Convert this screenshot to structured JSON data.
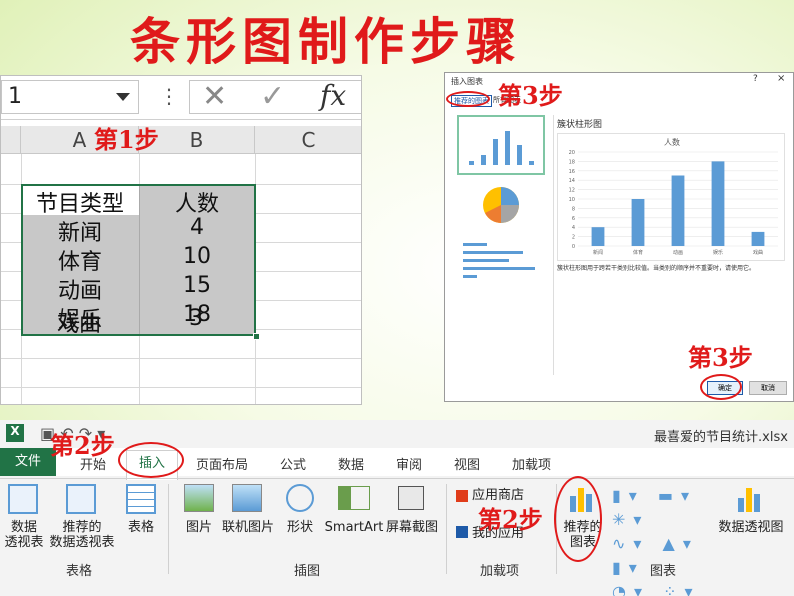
{
  "title": "条形图制作步骤",
  "steps": {
    "s1": "第1步",
    "s2a": "第2步",
    "s2b": "第2步",
    "s3a": "第3步",
    "s3b": "第3步"
  },
  "excel": {
    "namebox": "1",
    "formula_icons": [
      "cancel-icon",
      "enter-icon",
      "function-icon"
    ],
    "fx": "fx",
    "columns": [
      "A",
      "B",
      "C"
    ],
    "table": {
      "headers": [
        "节目类型",
        "人数"
      ],
      "rows": [
        [
          "新闻",
          "4"
        ],
        [
          "体育",
          "10"
        ],
        [
          "动画",
          "15"
        ],
        [
          "娱乐",
          "18"
        ],
        [
          "戏曲",
          "3"
        ]
      ]
    }
  },
  "dialog": {
    "title": "插入图表",
    "tabs": [
      "推荐的图表",
      "所有图表"
    ],
    "chart_type_name": "簇状柱形图",
    "description": "簇状柱形图用于跨若干类别比较值。当类别的顺序并不重要时，请使用它。",
    "ok": "确定",
    "cancel": "取消",
    "controls": [
      "?",
      "×"
    ]
  },
  "chart_data": {
    "type": "bar",
    "title": "人数",
    "categories": [
      "新闻",
      "体育",
      "动画",
      "娱乐",
      "戏曲"
    ],
    "values": [
      4,
      10,
      15,
      18,
      3
    ],
    "ylim": [
      0,
      20
    ],
    "yticks": [
      0,
      2,
      4,
      6,
      8,
      10,
      12,
      14,
      16,
      18,
      20
    ],
    "grid": true,
    "color": "#5b9bd5"
  },
  "ribbon": {
    "filename": "最喜爱的节目统计.xlsx -",
    "tabs": [
      "文件",
      "开始",
      "插入",
      "页面布局",
      "公式",
      "数据",
      "审阅",
      "视图",
      "加载项"
    ],
    "buttons": {
      "pivot": "数据\n透视表",
      "rec_pivot": "推荐的\n数据透视表",
      "table": "表格",
      "picture": "图片",
      "online_picture": "联机图片",
      "shapes": "形状",
      "smartart": "SmartArt",
      "screenshot": "屏幕截图",
      "app_store": "应用商店",
      "my_apps": "我的应用",
      "rec_chart": "推荐的\n图表",
      "pivot_chart": "数据透视图"
    },
    "groups": [
      "表格",
      "插图",
      "加载项",
      "图表"
    ],
    "colors": {
      "file_tab": "#217346",
      "accent": "#e01a1a"
    }
  }
}
